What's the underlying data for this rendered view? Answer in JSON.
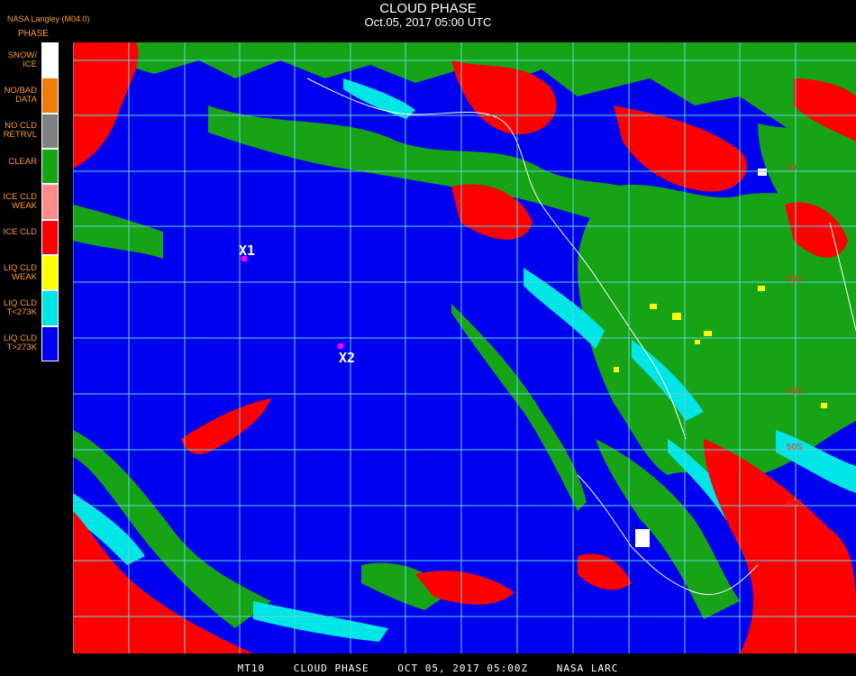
{
  "header": {
    "title": "CLOUD PHASE",
    "subtitle": "Oct.05, 2017 05:00 UTC",
    "product": "NASA Langley (M04.0)"
  },
  "legend": {
    "title": "PHASE",
    "items": [
      {
        "label": "SNOW/\nICE",
        "color": "#ffffff"
      },
      {
        "label": "NO/BAD\nDATA",
        "color": "#f07d0a"
      },
      {
        "label": "NO CLD\nRETRVL",
        "color": "#808080"
      },
      {
        "label": "CLEAR",
        "color": "#16a316"
      },
      {
        "label": "ICE CLD\nWEAK",
        "color": "#ff8a8a"
      },
      {
        "label": "ICE CLD",
        "color": "#ff0000"
      },
      {
        "label": "LIQ CLD\nWEAK",
        "color": "#ffff00"
      },
      {
        "label": "LIQ CLD\nT<273K",
        "color": "#00e5e5"
      },
      {
        "label": "LIQ CLD\nT>273K",
        "color": "#0000f0"
      }
    ]
  },
  "map": {
    "colors": {
      "ocean": "#0000f0",
      "clear": "#16a316",
      "ice": "#ff0000",
      "liq_cold": "#00e5e5",
      "liq_weak": "#ffff00",
      "snow": "#ffffff",
      "grid": "#5fd7d7",
      "coast": "#ffffff",
      "marker": "#ff00ff"
    },
    "markers": [
      {
        "id": "X1",
        "label": "X1"
      },
      {
        "id": "X2",
        "label": "X2"
      }
    ],
    "lat_labels": [
      "10",
      "30S",
      "40S",
      "50S",
      "60S"
    ]
  },
  "footer": {
    "sensor": "MT10",
    "product": "CLOUD PHASE",
    "date": "OCT 05, 2017 05:00Z",
    "source": "NASA LARC"
  }
}
